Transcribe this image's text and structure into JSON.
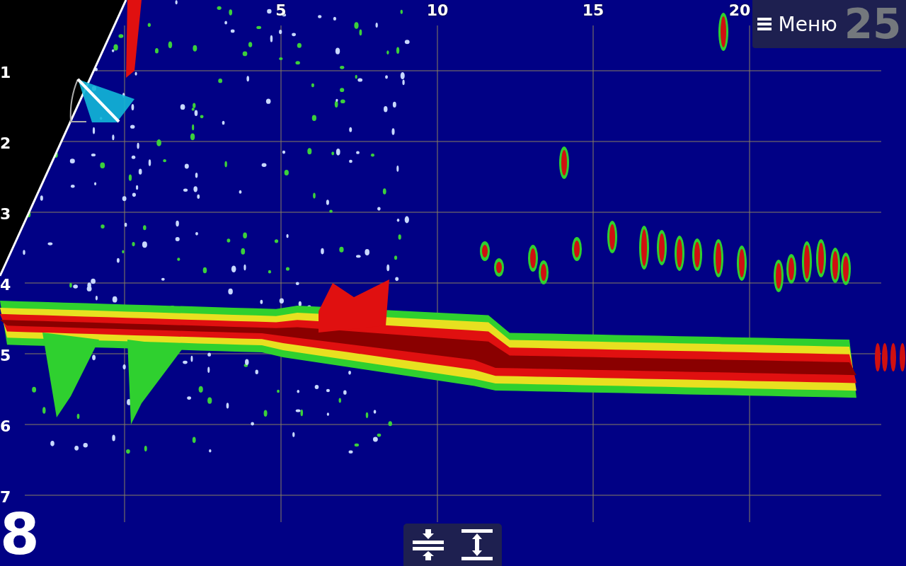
{
  "distance_scale": {
    "labels": [
      "5",
      "10",
      "15",
      "20"
    ]
  },
  "depth_scale": {
    "labels": [
      "1",
      "2",
      "3",
      "4",
      "5",
      "6",
      "7"
    ]
  },
  "depth_range": "8",
  "zoom_factor": "25",
  "menu_button": {
    "label": "Меню"
  }
}
